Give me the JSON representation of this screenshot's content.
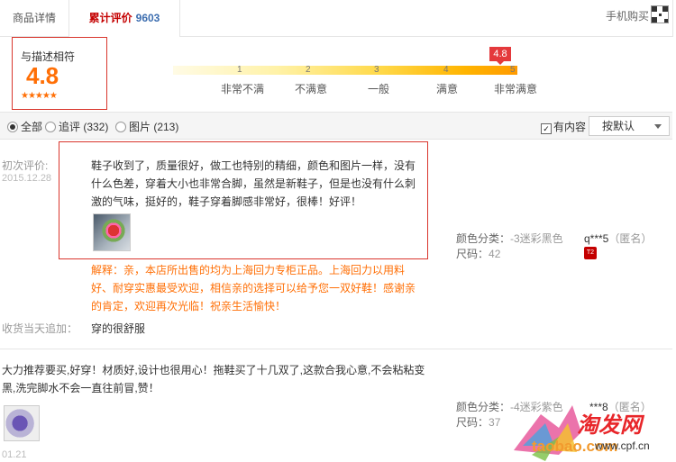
{
  "tabs": {
    "detail": "商品详情",
    "reviews": "累计评价",
    "reviews_count": "9603"
  },
  "mobile_buy": "手机购买",
  "rating": {
    "label": "与描述相符",
    "score": "4.8",
    "stars": "★★★★★",
    "badge": "4.8",
    "ticks": [
      "1",
      "2",
      "3",
      "4",
      "5"
    ],
    "scale_labels": [
      "非常不满",
      "不满意",
      "一般",
      "满意",
      "非常满意"
    ]
  },
  "filter": {
    "all": "全部",
    "followup": "追评 (332)",
    "images": "图片 (213)",
    "has_content": "有内容",
    "sort": "按默认"
  },
  "review1": {
    "initial_label": "初次评价:",
    "date": "2015.12.28",
    "text": "鞋子收到了，质量很好，做工也特别的精细，颜色和图片一样，没有什么色差，穿着大小也非常合脚，虽然是新鞋子，但是也没有什么刺激的气味，挺好的，鞋子穿着脚感非常好，很棒！好评！",
    "reply": "解释：亲，本店所出售的均为上海回力专柜正品。上海回力以用料好、耐穿实惠最受欢迎，相信亲的选择可以给予您一双好鞋！感谢亲的肯定，欢迎再次光临！祝亲生活愉快！",
    "append_label": "收货当天追加：",
    "append_text": "穿的很舒服",
    "color_label": "颜色分类：",
    "color_value": "-3迷彩黑色",
    "size_label": "尺码：",
    "size_value": "42",
    "user": "q***5",
    "anon": "（匿名）",
    "user_badge": "T2"
  },
  "review2": {
    "text": "大力推荐要买,好穿！材质好,设计也很用心！拖鞋买了十几双了,这款合我心意,不会粘粘变黑,洗完脚水不会一直往前冒,赞！",
    "date": "01.21",
    "color_label": "颜色分类：",
    "color_value": "-4迷彩紫色",
    "size_label": "尺码：",
    "size_value": "37",
    "user": "***8",
    "anon": "（匿名）"
  },
  "watermark": {
    "brand": "淘发网",
    "url": "taobao.com",
    "url2": "www.cpf.cn"
  }
}
